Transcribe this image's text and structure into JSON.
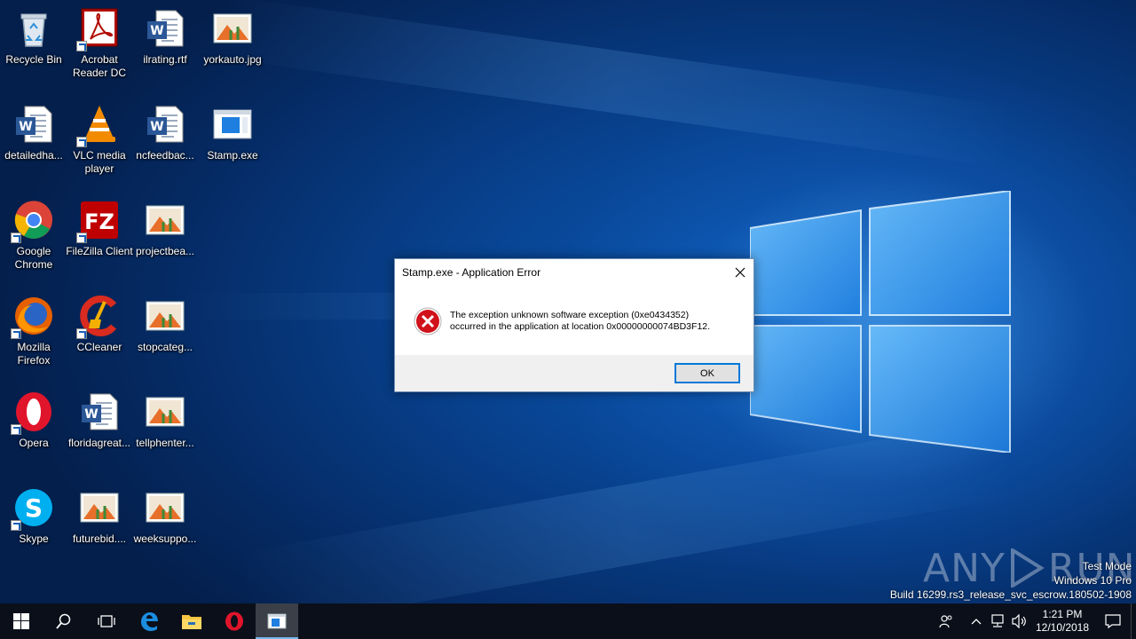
{
  "desktop": {
    "icons": [
      {
        "label": "Recycle Bin",
        "icon": "recycle-bin-icon"
      },
      {
        "label": "Acrobat Reader DC",
        "icon": "acrobat-icon"
      },
      {
        "label": "ilrating.rtf",
        "icon": "word-document-icon"
      },
      {
        "label": "yorkauto.jpg",
        "icon": "image-file-icon"
      },
      {
        "label": "detailedha...",
        "icon": "word-document-icon"
      },
      {
        "label": "VLC media player",
        "icon": "vlc-icon"
      },
      {
        "label": "ncfeedbac...",
        "icon": "word-document-icon"
      },
      {
        "label": "Stamp.exe",
        "icon": "executable-icon"
      },
      {
        "label": "Google Chrome",
        "icon": "chrome-icon"
      },
      {
        "label": "FileZilla Client",
        "icon": "filezilla-icon"
      },
      {
        "label": "projectbea...",
        "icon": "image-file-icon"
      },
      {
        "label": "Mozilla Firefox",
        "icon": "firefox-icon"
      },
      {
        "label": "CCleaner",
        "icon": "ccleaner-icon"
      },
      {
        "label": "stopcateg...",
        "icon": "image-file-icon"
      },
      {
        "label": "Opera",
        "icon": "opera-icon"
      },
      {
        "label": "floridagreat...",
        "icon": "word-document-icon"
      },
      {
        "label": "tellphenter...",
        "icon": "image-file-icon"
      },
      {
        "label": "Skype",
        "icon": "skype-icon"
      },
      {
        "label": "futurebid....",
        "icon": "image-file-icon"
      },
      {
        "label": "weeksuppo...",
        "icon": "image-file-icon"
      }
    ]
  },
  "dialog": {
    "title": "Stamp.exe - Application Error",
    "message_line1": "The exception unknown software exception (0xe0434352)",
    "message_line2": "occurred in the application at location 0x00000000074BD3F12.",
    "ok_label": "OK"
  },
  "watermark": {
    "left": "ANY",
    "right": "RUN"
  },
  "system_info": {
    "line1": "Test Mode",
    "line2": "Windows 10 Pro",
    "line3": "Build 16299.rs3_release_svc_escrow.180502-1908"
  },
  "taskbar": {
    "time": "1:21 PM",
    "date": "12/10/2018"
  },
  "colors": {
    "accent": "#0078d7",
    "taskbar": "#0a0f1a",
    "error_red": "#d0121b"
  }
}
